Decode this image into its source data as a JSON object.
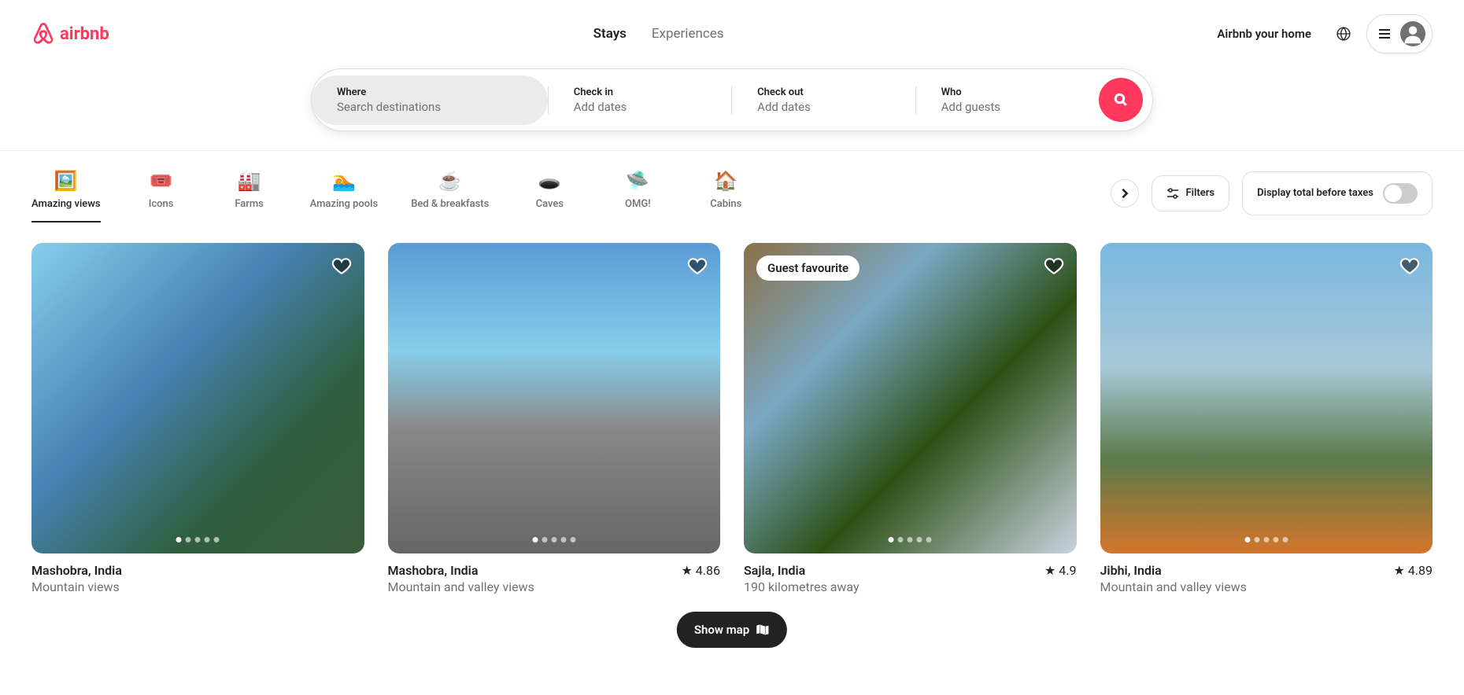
{
  "header": {
    "logo_text": "airbnb",
    "tabs": {
      "stays": "Stays",
      "experiences": "Experiences"
    },
    "host_link": "Airbnb your home"
  },
  "search": {
    "where": {
      "label": "Where",
      "placeholder": "Search destinations"
    },
    "checkin": {
      "label": "Check in",
      "placeholder": "Add dates"
    },
    "checkout": {
      "label": "Check out",
      "placeholder": "Add dates"
    },
    "who": {
      "label": "Who",
      "placeholder": "Add guests"
    }
  },
  "categories": [
    {
      "label": "Amazing views",
      "active": true
    },
    {
      "label": "Icons"
    },
    {
      "label": "Farms"
    },
    {
      "label": "Amazing pools"
    },
    {
      "label": "Bed & breakfasts"
    },
    {
      "label": "Caves"
    },
    {
      "label": "OMG!"
    },
    {
      "label": "Cabins"
    }
  ],
  "filters_label": "Filters",
  "tax_toggle_label": "Display total before taxes",
  "listings": [
    {
      "title": "Mashobra, India",
      "subtitle": "Mountain views",
      "rating": "",
      "badge": ""
    },
    {
      "title": "Mashobra, India",
      "subtitle": "Mountain and valley views",
      "rating": "4.86",
      "badge": ""
    },
    {
      "title": "Sajla, India",
      "subtitle": "190 kilometres away",
      "rating": "4.9",
      "badge": "Guest favourite"
    },
    {
      "title": "Jibhi, India",
      "subtitle": "Mountain and valley views",
      "rating": "4.89",
      "badge": ""
    }
  ],
  "map_button": "Show map"
}
